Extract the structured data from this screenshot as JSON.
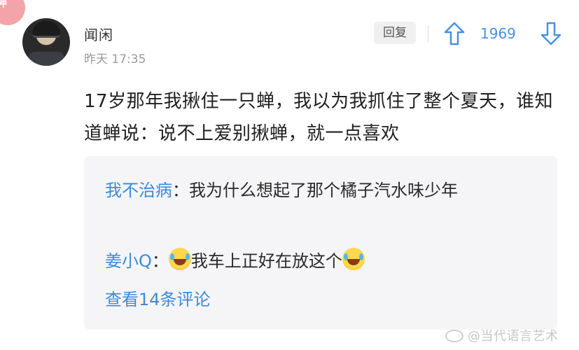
{
  "badge": {
    "label": "神",
    "color": "#f4a4a8"
  },
  "comment": {
    "username": "闻闲",
    "timestamp": "昨天 17:35",
    "reply_label": "回复",
    "vote_count": "1969",
    "text": "17岁那年我揪住一只蝉，我以为我抓住了整个夏天，谁知道蝉说：说不上爱别揪蝉，就一点喜欢"
  },
  "replies": [
    {
      "user": "我不治病",
      "separator": "：",
      "text": "我为什么想起了那个橘子汽水味少年"
    },
    {
      "user": "姜小Q",
      "separator": "：",
      "text_after_emoji": "我车上正好在放这个"
    }
  ],
  "view_more_label": "查看14条评论",
  "watermark": "@当代语言艺术",
  "icons": {
    "upvote": "arrow-up-icon",
    "downvote": "arrow-down-icon",
    "emoji": "laughing-tears-emoji-icon",
    "weibo": "weibo-icon"
  },
  "colors": {
    "accent": "#4a90e2",
    "link": "#3b8bd9",
    "panel": "#f5f5f7"
  }
}
